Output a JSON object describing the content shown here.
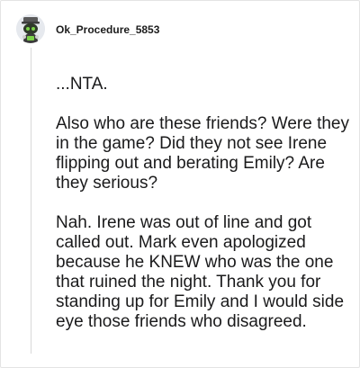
{
  "comment": {
    "username": "Ok_Procedure_5853",
    "avatar_icon": "snoo-avatar-icon",
    "paragraphs": [
      "...NTA.",
      "Also who are these friends? Were they in the game? Did they not see Irene flipping out and berating Emily? Are they serious?",
      "Nah. Irene was out of line and got called out. Mark even apologized because he KNEW who was the one that ruined the night. Thank you for standing up for Emily and I would side eye those friends who disagreed."
    ]
  }
}
